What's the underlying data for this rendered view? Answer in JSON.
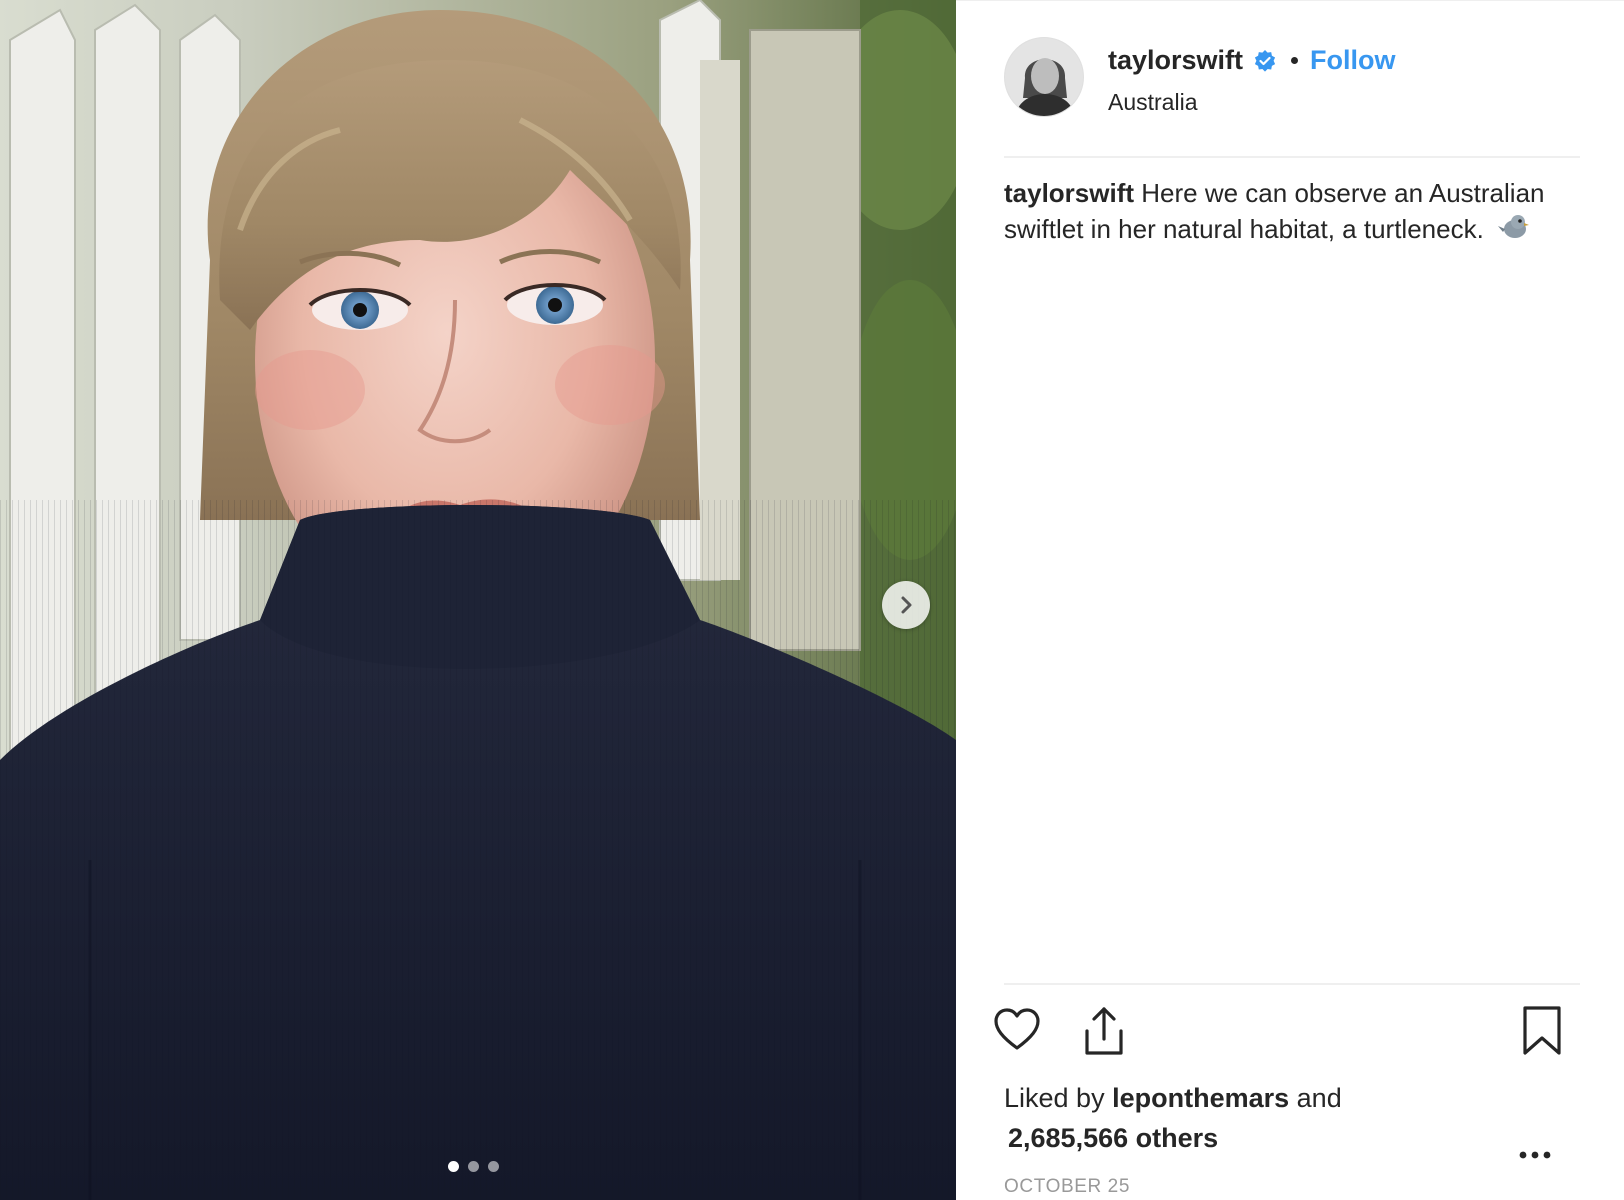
{
  "post": {
    "username": "taylorswift",
    "verified": true,
    "follow_label": "Follow",
    "location": "Australia",
    "caption_username": "taylorswift",
    "caption_text": "Here we can observe an Australian swiftlet in her natural habitat, a turtleneck.",
    "caption_emoji_icon": "bird-icon",
    "liked_by_prefix": "Liked by",
    "liked_by_user": "leponthemars",
    "liked_by_and": "and",
    "likes_count": "2,685,566 others",
    "date": "OCTOBER 25"
  },
  "carousel": {
    "total_slides": 3,
    "active_slide": 1,
    "next_icon": "chevron-right-icon"
  },
  "actions": {
    "like_icon": "heart-icon",
    "share_icon": "share-icon",
    "save_icon": "bookmark-icon",
    "more_icon": "more-icon"
  },
  "colors": {
    "text": "#262626",
    "link_blue": "#3897f0",
    "muted": "#999999",
    "divider": "#efefef"
  }
}
